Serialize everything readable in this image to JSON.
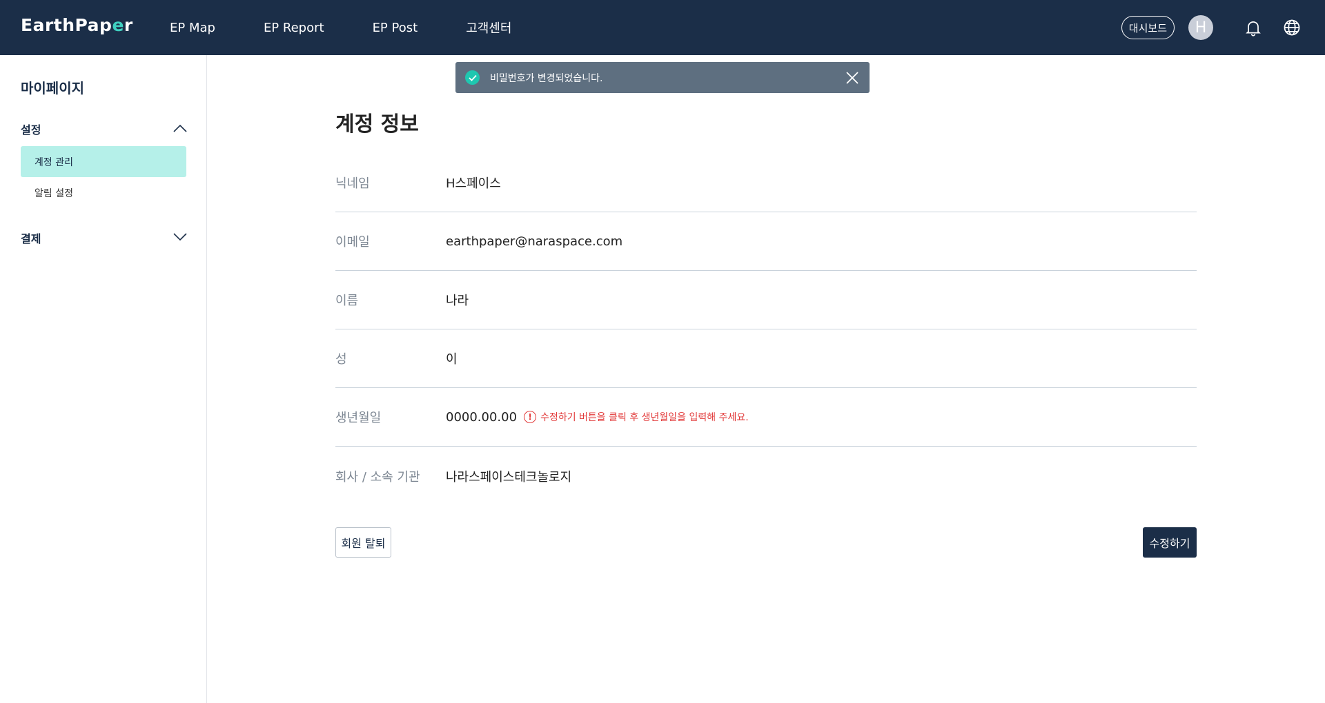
{
  "header": {
    "logo_text_a": "EarthPap",
    "logo_text_accent": "e",
    "logo_text_b": "r",
    "nav": [
      {
        "label": "EP Map"
      },
      {
        "label": "EP Report"
      },
      {
        "label": "EP Post"
      },
      {
        "label": "고객센터"
      }
    ],
    "dashboard_label": "대시보드",
    "avatar_initial": "H",
    "bell_icon": "bell-icon",
    "globe_icon": "globe-icon"
  },
  "sidebar": {
    "title": "마이페이지",
    "sections": [
      {
        "label": "설정",
        "expanded": true,
        "items": [
          {
            "label": "계정 관리",
            "active": true
          },
          {
            "label": "알림 설정",
            "active": false
          }
        ]
      },
      {
        "label": "결제",
        "expanded": false
      }
    ]
  },
  "toast": {
    "message": "비밀번호가 변경되었습니다."
  },
  "main": {
    "title": "계정 정보",
    "rows": [
      {
        "label": "닉네임",
        "value": "H스페이스"
      },
      {
        "label": "이메일",
        "value": "earthpaper@naraspace.com"
      },
      {
        "label": "이름",
        "value": "나라"
      },
      {
        "label": "성",
        "value": "이"
      },
      {
        "label": "생년월일",
        "value": "0000.00.00",
        "warning": "수정하기 버튼을 클릭 후 생년월일을 입력해 주세요."
      },
      {
        "label": "회사 / 소속 기관",
        "value": "나라스페이스테크놀로지"
      }
    ],
    "withdraw_label": "회원 탈퇴",
    "edit_label": "수정하기"
  },
  "colors": {
    "header_bg": "#1b2e48",
    "accent": "#3fd0c0",
    "active_menu_bg": "#b5f0e9",
    "toast_bg": "#5e6f80",
    "warning": "#e23a3a"
  }
}
